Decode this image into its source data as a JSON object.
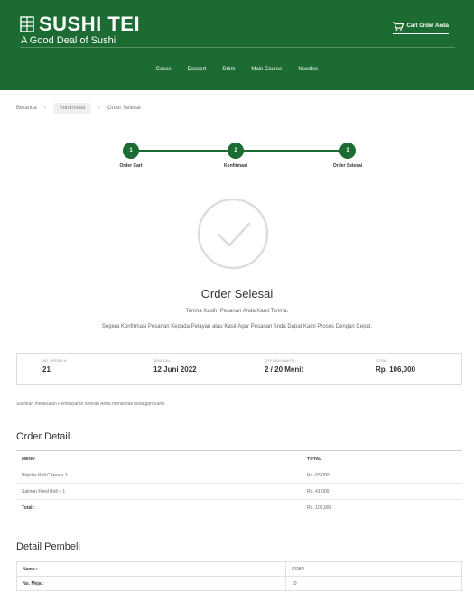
{
  "header": {
    "brand": "SUSHI TEI",
    "tagline": "A Good  Deal of Sushi",
    "cart_label": "Cart Order Anda",
    "nav": [
      "Cakes",
      "Dessert",
      "Drink",
      "Main Course",
      "Noodles"
    ],
    "bg_color": "#1c6b32"
  },
  "breadcrumb": [
    "Beranda",
    "Konfirmasi",
    "Order Selesai"
  ],
  "steps": [
    {
      "number": "1",
      "label": "Order Cart"
    },
    {
      "number": "2",
      "label": "Konfirmasi"
    },
    {
      "number": "3",
      "label": "Order Selesai"
    }
  ],
  "done": {
    "icon": "check-circle-icon",
    "title": "Order Selesai",
    "thanks": "Terima Kasih, Pesanan Anda Kami Terima.",
    "note": "Segera Konfirmasi Pesanan Kepada Pelayan atau Kasir Agar Pesanan Anda Dapat Kami Proses Dengan Cepat."
  },
  "summary": [
    {
      "label": "NO. ORDER #:",
      "value": "21"
    },
    {
      "label": "TANGGAL :",
      "value": "12 Juni 2022"
    },
    {
      "label": "QTY DAN WAKTU :",
      "value": "2 / 20 Menit"
    },
    {
      "label": "TOTAL :",
      "value": "Rp. 106,000"
    }
  ],
  "payment_note": "Silahkan melakukan Pembayaran setelah Anda menikmati hidangan Kami.",
  "order_detail": {
    "title": "Order Detail",
    "headers": [
      "MENU",
      "TOTAL"
    ],
    "rows": [
      {
        "menu": "Hojicha Roll Cakes × 1",
        "total": "Rp. 65,000"
      },
      {
        "menu": "Salmon Fried Roll × 1",
        "total": "Rp. 41,000"
      }
    ],
    "total_label": "Total :",
    "total_value": "Rp. 106,000"
  },
  "buyer": {
    "title": "Detail Pembeli",
    "rows": [
      {
        "label": "Nama :",
        "value": "COBA"
      },
      {
        "label": "No. Meja :",
        "value": "10"
      }
    ]
  }
}
